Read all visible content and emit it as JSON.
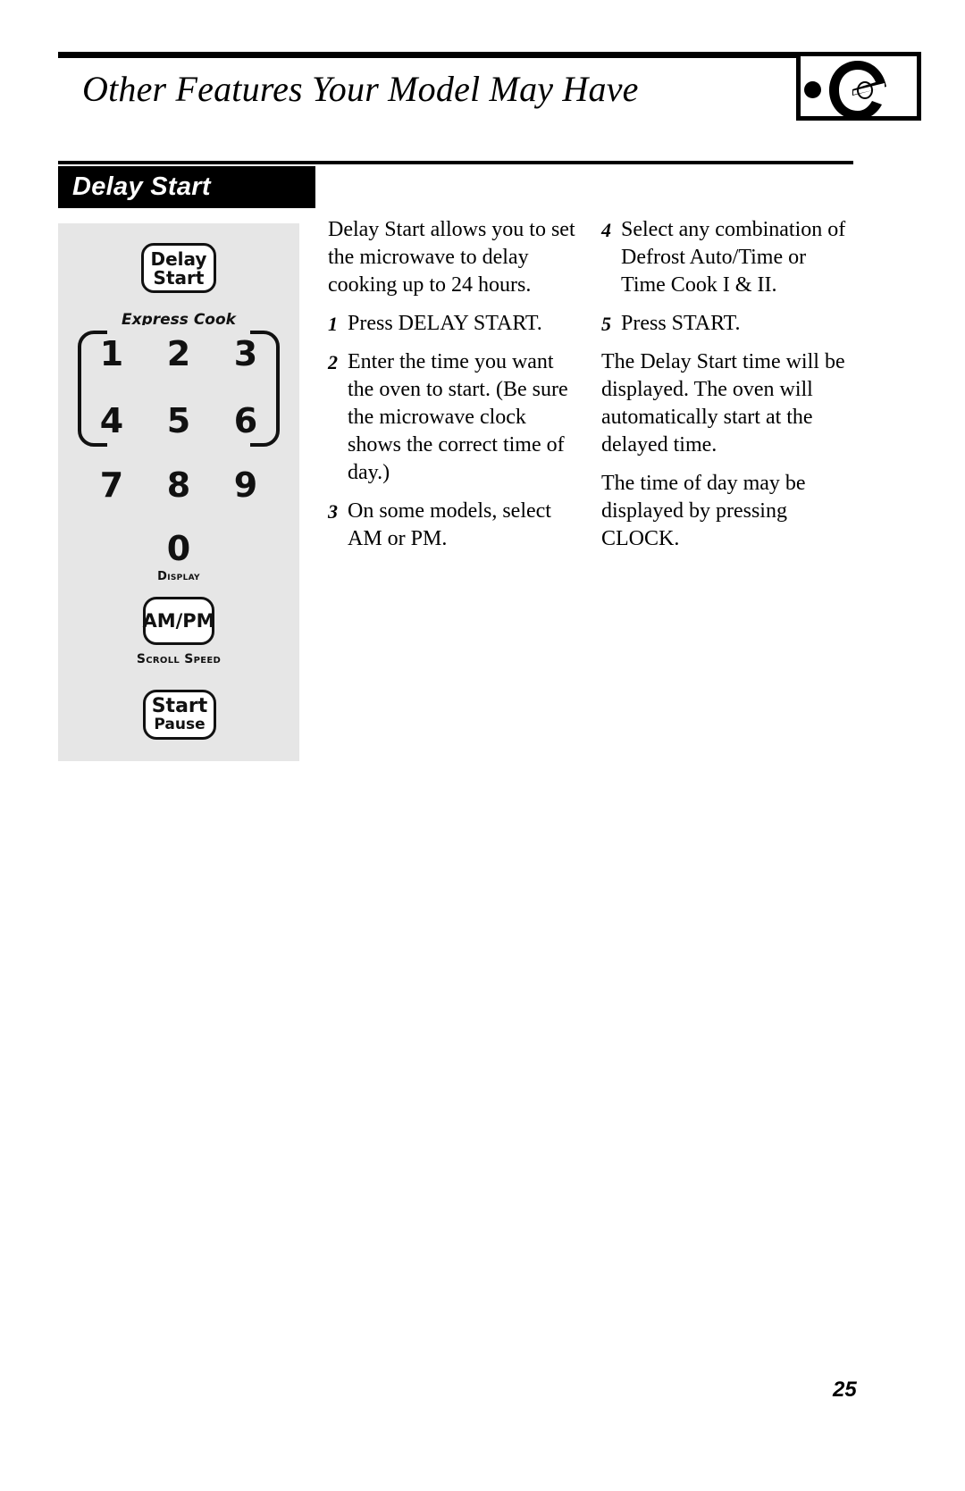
{
  "header": {
    "title": "Other Features Your Model May Have",
    "logo_name": "ge-monogram-logo"
  },
  "section": {
    "title": "Delay Start"
  },
  "control_panel": {
    "delay_start_key": {
      "line1": "Delay",
      "line2": "Start"
    },
    "express_cook_label": "Express Cook",
    "keypad": [
      "1",
      "2",
      "3",
      "4",
      "5",
      "6",
      "7",
      "8",
      "9"
    ],
    "zero_key": "0",
    "display_label": "Display",
    "ampm_key": "AM/PM",
    "scroll_speed_label": "Scroll Speed",
    "start_key": {
      "line1": "Start",
      "line2": "Pause"
    }
  },
  "middle_column": {
    "intro": "Delay Start allows you to set the microwave to delay cooking up to 24 hours.",
    "steps": [
      {
        "num": "1",
        "text": "Press DELAY START."
      },
      {
        "num": "2",
        "text": "Enter the time you want the oven to start. (Be sure the microwave clock shows the correct time of day.)"
      },
      {
        "num": "3",
        "text": "On some models, select AM or PM."
      }
    ]
  },
  "right_column": {
    "steps": [
      {
        "num": "4",
        "text": "Select any combination of Defrost Auto/Time or Time Cook I & II."
      },
      {
        "num": "5",
        "text": "Press START."
      }
    ],
    "paragraphs": [
      "The Delay Start time will be displayed. The oven will automatically start at the delayed time.",
      "The time of day may be displayed by pressing CLOCK."
    ]
  },
  "footer": {
    "page_number": "25"
  },
  "colors": {
    "text": "#000000",
    "section_bar_bg": "#000000",
    "section_bar_text": "#ffffff",
    "panel_bg": "#e6e6e6",
    "key_bg": "#ffffff"
  }
}
